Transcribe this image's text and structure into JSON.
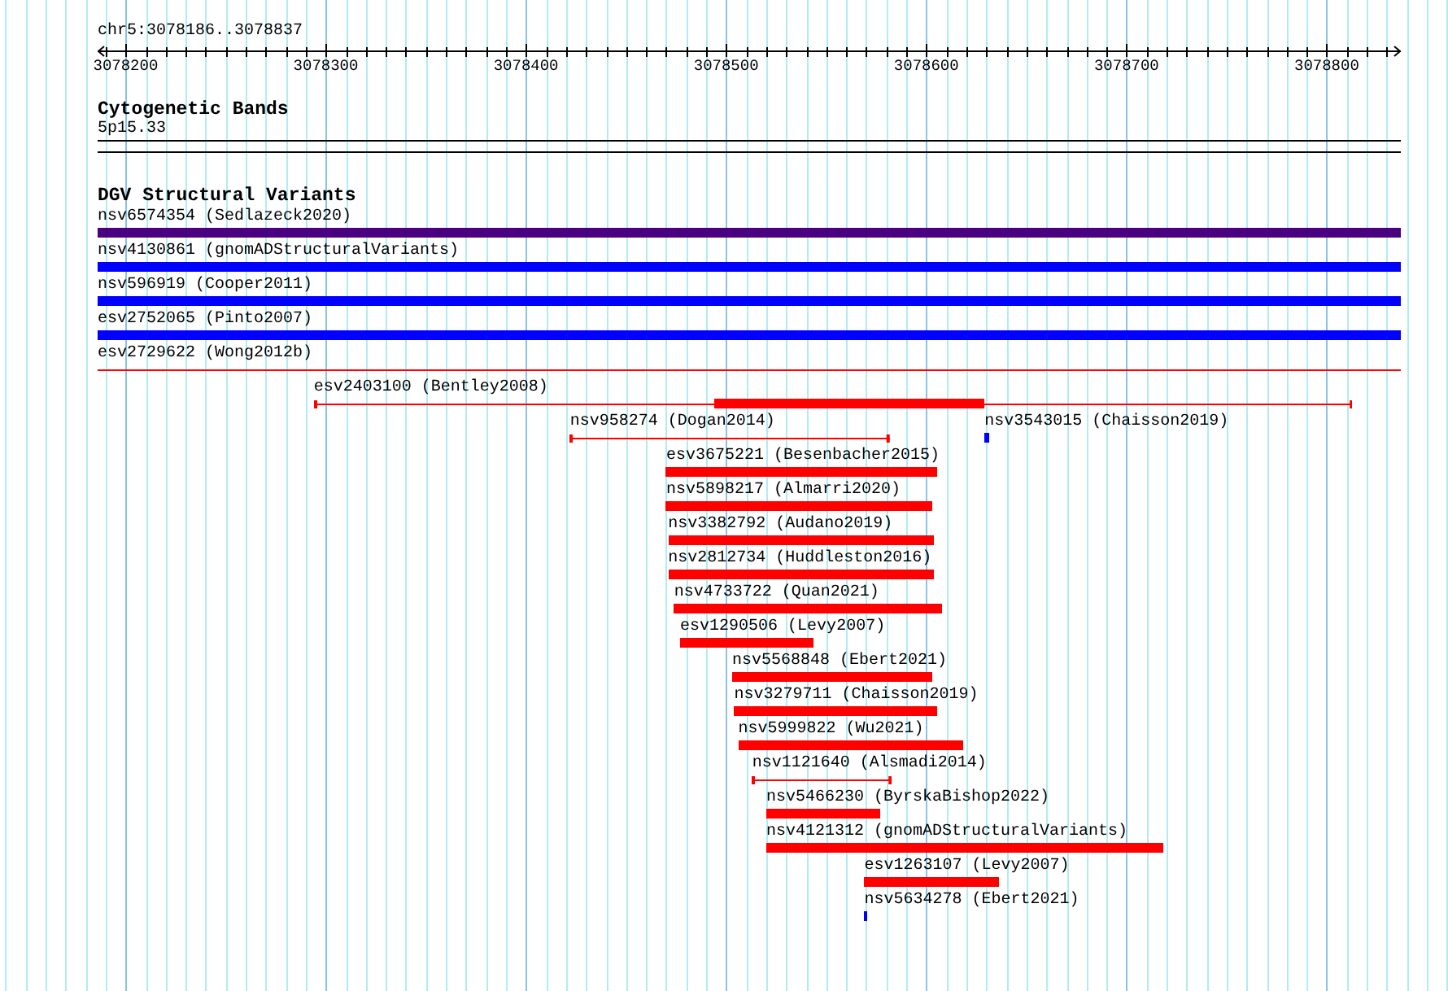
{
  "view": {
    "title": "chr5:3078186..3078837"
  },
  "ruler": {
    "labels": [
      "3078200",
      "3078300",
      "3078400",
      "3078500",
      "3078600",
      "3078700",
      "3078800"
    ]
  },
  "cytoband_track": {
    "title": "Cytogenetic Bands",
    "band": {
      "label": "5p15.33"
    }
  },
  "dgv_track": {
    "title": "DGV Structural Variants",
    "rows": [
      [
        {
          "label": "nsv6574354 (Sedlazeck2020)",
          "kind": "bar",
          "color": "#4b0082"
        }
      ],
      [
        {
          "label": "nsv4130861 (gnomADStructuralVariants)",
          "kind": "bar",
          "color": "#0000ff"
        }
      ],
      [
        {
          "label": "nsv596919 (Cooper2011)",
          "kind": "bar",
          "color": "#0000ff"
        }
      ],
      [
        {
          "label": "esv2752065 (Pinto2007)",
          "kind": "bar",
          "color": "#0000ff"
        }
      ],
      [
        {
          "label": "esv2729622 (Wong2012b)",
          "kind": "line",
          "color": "#ff0000"
        }
      ],
      [
        {
          "label": "esv2403100 (Bentley2008)",
          "kind": "line",
          "color": "#ff0000"
        }
      ],
      [
        {
          "label": "nsv958274 (Dogan2014)",
          "kind": "line",
          "color": "#ff0000"
        },
        {
          "label": "nsv3543015 (Chaisson2019)",
          "kind": "bar",
          "color": "#0000ff"
        }
      ],
      [
        {
          "label": "esv3675221 (Besenbacher2015)",
          "kind": "bar",
          "color": "#ff0000"
        }
      ],
      [
        {
          "label": "nsv5898217 (Almarri2020)",
          "kind": "bar",
          "color": "#ff0000"
        }
      ],
      [
        {
          "label": "nsv3382792 (Audano2019)",
          "kind": "bar",
          "color": "#ff0000"
        }
      ],
      [
        {
          "label": "nsv2812734 (Huddleston2016)",
          "kind": "bar",
          "color": "#ff0000"
        }
      ],
      [
        {
          "label": "nsv4733722 (Quan2021)",
          "kind": "bar",
          "color": "#ff0000"
        }
      ],
      [
        {
          "label": "esv1290506 (Levy2007)",
          "kind": "bar",
          "color": "#ff0000"
        }
      ],
      [
        {
          "label": "nsv5568848 (Ebert2021)",
          "kind": "bar",
          "color": "#ff0000"
        }
      ],
      [
        {
          "label": "nsv3279711 (Chaisson2019)",
          "kind": "bar",
          "color": "#ff0000"
        }
      ],
      [
        {
          "label": "nsv5999822 (Wu2021)",
          "kind": "bar",
          "color": "#ff0000"
        }
      ],
      [
        {
          "label": "nsv1121640 (Alsmadi2014)",
          "kind": "line",
          "color": "#ff0000"
        }
      ],
      [
        {
          "label": "nsv5466230 (ByrskaBishop2022)",
          "kind": "bar",
          "color": "#ff0000"
        }
      ],
      [
        {
          "label": "nsv4121312 (gnomADStructuralVariants)",
          "kind": "bar",
          "color": "#ff0000"
        }
      ],
      [
        {
          "label": "esv1263107 (Levy2007)",
          "kind": "bar",
          "color": "#ff0000"
        }
      ],
      [
        {
          "label": "nsv5634278 (Ebert2021)",
          "kind": "bar",
          "color": "#0000ff"
        }
      ]
    ]
  }
}
